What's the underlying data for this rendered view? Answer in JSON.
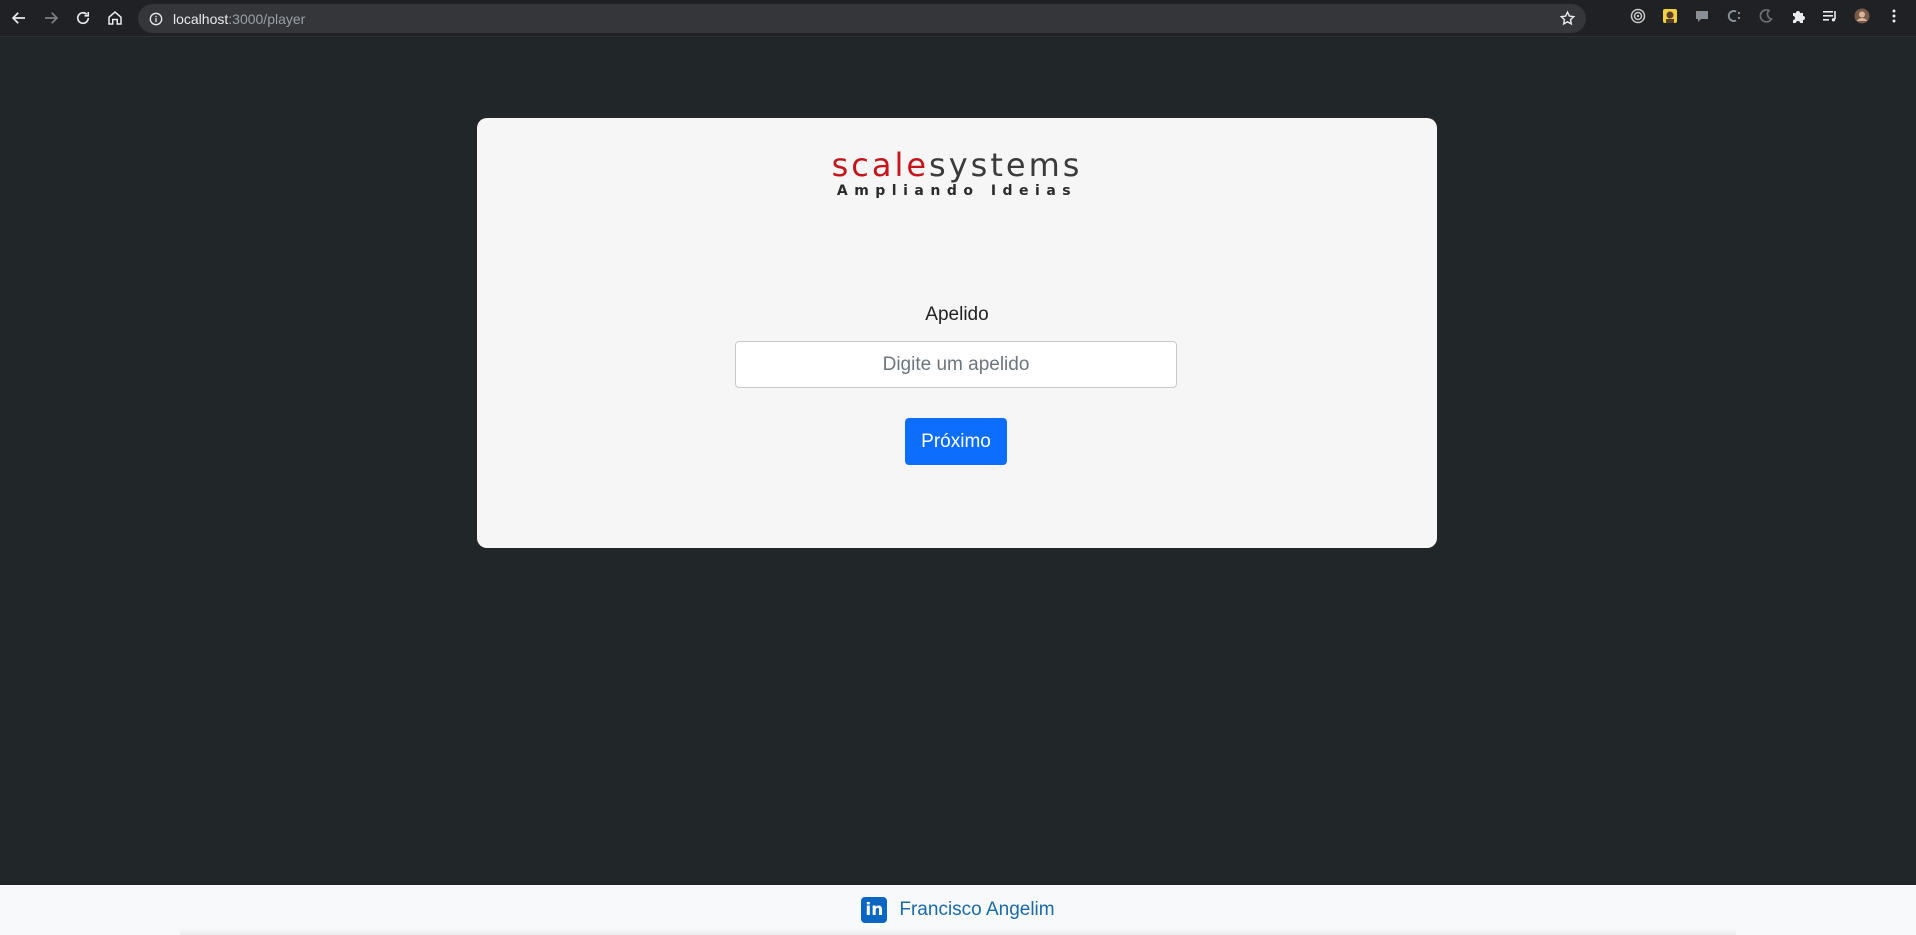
{
  "browser": {
    "url_host": "localhost",
    "url_path": ":3000/player",
    "icons": [
      "back-arrow-icon",
      "forward-arrow-icon",
      "reload-icon",
      "home-icon",
      "info-icon",
      "star-icon"
    ],
    "extensions": [
      "target-extension-icon",
      "avatar-extension-icon",
      "chat-extension-icon",
      "c-extension-icon",
      "moon-extension-icon",
      "puzzle-extensions-icon",
      "reading-list-icon",
      "profile-avatar-icon",
      "kebab-menu-icon"
    ]
  },
  "logo": {
    "scale": "scale",
    "systems": "systems",
    "tagline": "Ampliando Ideias",
    "colors": {
      "scale": "#c4161c",
      "systems": "#3b3b3b"
    }
  },
  "form": {
    "label": "Apelido",
    "placeholder": "Digite um apelido",
    "value": "",
    "submit_label": "Próximo",
    "accent": "#0d6efd"
  },
  "footer": {
    "link_text": "Francisco Angelim",
    "icon": "linkedin-icon",
    "icon_text": "in"
  },
  "theme": {
    "background": "#212729",
    "card": "#f6f6f6"
  }
}
